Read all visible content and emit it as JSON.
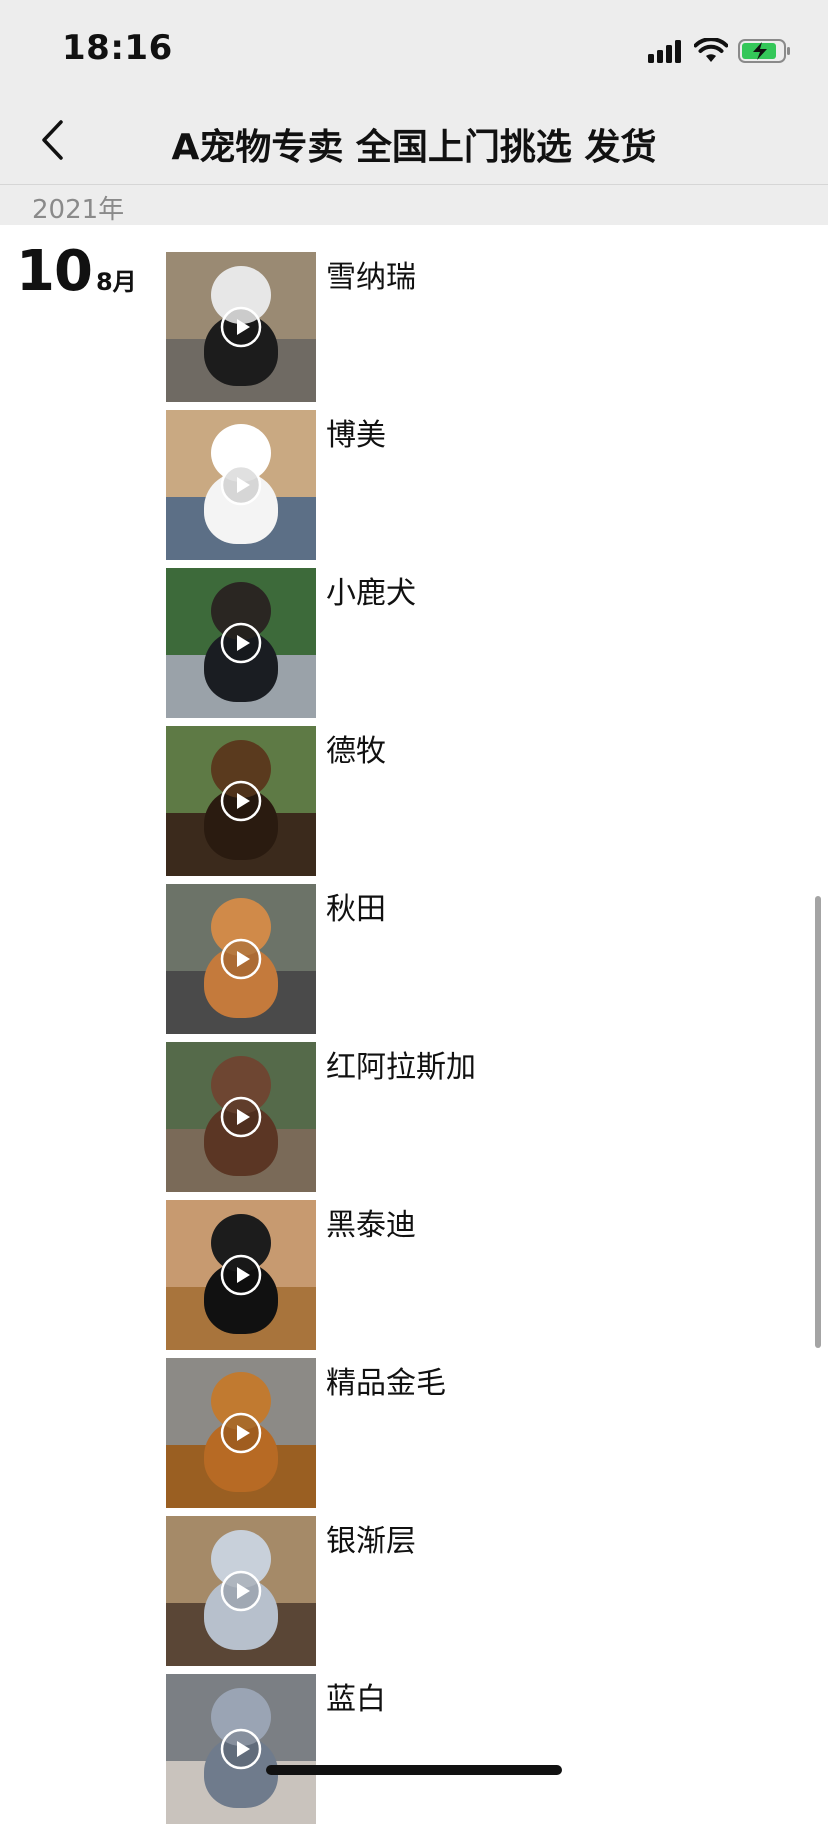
{
  "status_bar": {
    "time": "18:16",
    "icons": [
      "cellular-signal-icon",
      "wifi-icon",
      "battery-charging-icon"
    ],
    "battery_color": "#34c759"
  },
  "nav": {
    "back_icon": "chevron-left-icon",
    "title": "A宠物专卖 全国上门挑选 发货"
  },
  "timeline": {
    "year": "2021年",
    "day": "10",
    "month": "8月"
  },
  "posts": [
    {
      "caption": "雪纳瑞",
      "type": "video",
      "colors": {
        "bg": "#9a8a73",
        "floor": "#6f6a63",
        "body": "#1c1c1c",
        "head": "#e7e7e7"
      }
    },
    {
      "caption": "博美",
      "type": "video",
      "colors": {
        "bg": "#c9a982",
        "floor": "#5c6f86",
        "body": "#f4f4f4",
        "head": "#ffffff"
      }
    },
    {
      "caption": "小鹿犬",
      "type": "video",
      "colors": {
        "bg": "#3d6a3a",
        "floor": "#9aa2a9",
        "body": "#1a1d22",
        "head": "#2a2622"
      }
    },
    {
      "caption": "德牧",
      "type": "video",
      "colors": {
        "bg": "#5e7a45",
        "floor": "#3b2a1c",
        "body": "#2a1b10",
        "head": "#5a3a1e"
      }
    },
    {
      "caption": "秋田",
      "type": "video",
      "colors": {
        "bg": "#6c7368",
        "floor": "#4a4a4a",
        "body": "#c47a3c",
        "head": "#d08a49"
      }
    },
    {
      "caption": "红阿拉斯加",
      "type": "video",
      "colors": {
        "bg": "#556a4a",
        "floor": "#7a6a58",
        "body": "#5b3624",
        "head": "#6e4632"
      }
    },
    {
      "caption": "黑泰迪",
      "type": "video",
      "colors": {
        "bg": "#c79a70",
        "floor": "#a8743c",
        "body": "#111111",
        "head": "#1c1c1c"
      }
    },
    {
      "caption": "精品金毛",
      "type": "video",
      "colors": {
        "bg": "#8c8a86",
        "floor": "#9a5f22",
        "body": "#b76a24",
        "head": "#c17a30"
      }
    },
    {
      "caption": "银渐层",
      "type": "video",
      "colors": {
        "bg": "#a58a68",
        "floor": "#5a4636",
        "body": "#b7c0cc",
        "head": "#c8d0da"
      }
    },
    {
      "caption": "蓝白",
      "type": "video",
      "colors": {
        "bg": "#7b7f84",
        "floor": "#c9c3bd",
        "body": "#6f7b8c",
        "head": "#9aa4b4"
      }
    }
  ]
}
